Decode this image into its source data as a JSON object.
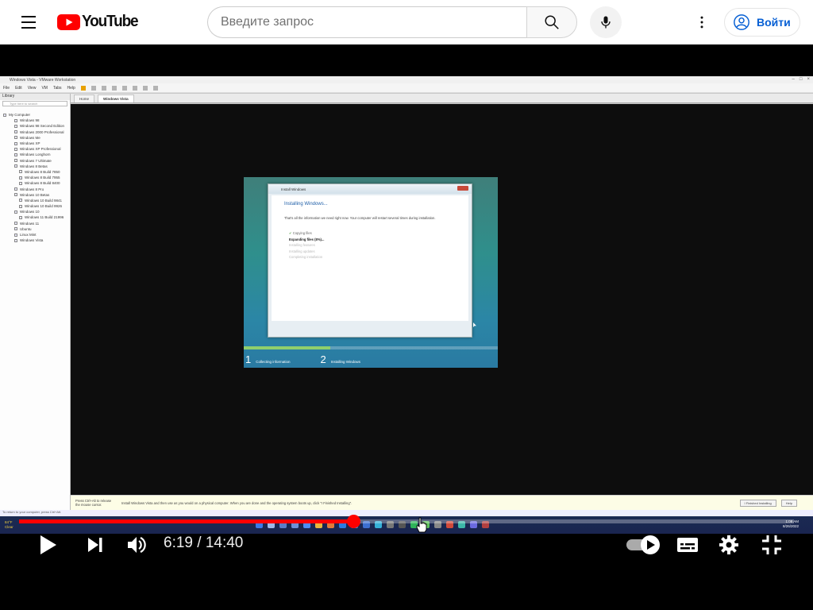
{
  "header": {
    "logo_text": "YouTube",
    "search_placeholder": "Введите запрос",
    "signin_label": "Войти",
    "icons": [
      "menu-icon",
      "youtube-logo-icon",
      "search-icon",
      "mic-icon",
      "more-vert-icon",
      "account-circle-icon"
    ],
    "colors": {
      "brand_red": "#ff0000",
      "link_blue": "#065fd4"
    }
  },
  "video": {
    "vm_window": {
      "title": "Windows Vista - VMware Workstation",
      "menu": [
        "File",
        "Edit",
        "View",
        "VM",
        "Tabs",
        "Help"
      ],
      "library_title": "Library",
      "library_search": "Type here to search",
      "library_items": [
        "My Computer",
        "Windows 98",
        "Windows 98 Second Edition",
        "Windows 2000 Professional",
        "Windows Me",
        "Windows XP",
        "Windows XP Professional",
        "Windows Longhorn",
        "Windows 7 Ultimate",
        "Windows 8 Betas",
        "Windows 8 Build 7850",
        "Windows 8 Build 7955",
        "Windows 8 Build 8400",
        "Windows 8 Pro",
        "Windows 10 Betas",
        "Windows 10 Build 9841",
        "Windows 10 Build 9926",
        "Windows 10",
        "Windows 11 Build 21996",
        "Windows 11",
        "Ubuntu",
        "Linux Mint",
        "Windows Vista"
      ],
      "tabs": [
        "Home",
        "Windows Vista"
      ],
      "hint_text": "Install Windows Vista and then use as you would on a physical computer. When you are done and the operating system boots up, click \"I Finished Installing\".",
      "hint_left": "Press Ctrl+Alt to release the mouse cursor.",
      "hint_button": "I Finished Installing",
      "help_button": "Help",
      "statusbar": "To return to your computer, press Ctrl+Alt.",
      "taskbar_clock": [
        "1:08 AM",
        "8/26/2022"
      ],
      "taskbar_weather": [
        "84°F",
        "Clear"
      ]
    },
    "installer": {
      "dialog_title": "Install Windows",
      "heading": "Installing Windows...",
      "description": "That's all the information we need right now. Your computer will restart several times during installation.",
      "steps": [
        {
          "label": "Copying files",
          "state": "done"
        },
        {
          "label": "Expanding files (8%)...",
          "state": "current"
        },
        {
          "label": "Installing features",
          "state": "pending"
        },
        {
          "label": "Installing updates",
          "state": "pending"
        },
        {
          "label": "Completing installation",
          "state": "pending"
        }
      ],
      "phases": [
        {
          "num": "1",
          "label": "Collecting information"
        },
        {
          "num": "2",
          "label": "Installing Windows"
        }
      ],
      "progress_fraction": 0.34
    }
  },
  "controls": {
    "current_time": "6:19",
    "separator": " / ",
    "duration": "14:40",
    "played_fraction": 0.431,
    "buffered_fraction": 0.441,
    "icons": [
      "play-icon",
      "next-icon",
      "volume-icon",
      "autoplay-toggle-icon",
      "subtitles-icon",
      "settings-icon",
      "exit-fullscreen-icon"
    ],
    "autoplay_on": true
  }
}
